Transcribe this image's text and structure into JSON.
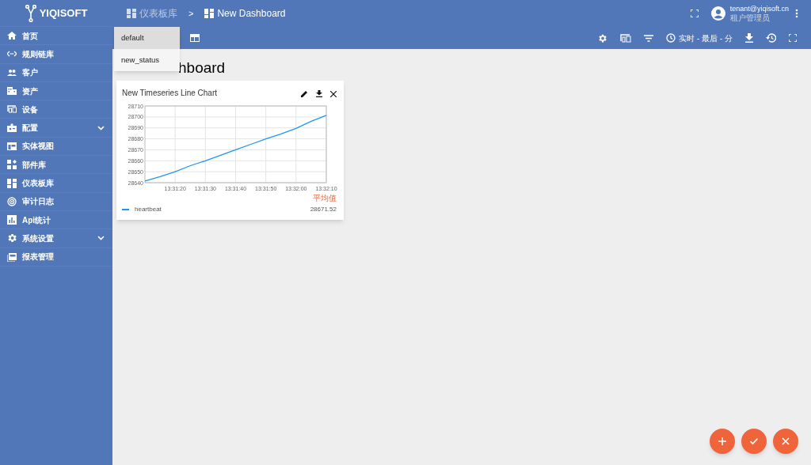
{
  "logo": {
    "text": "YIQISOFT"
  },
  "breadcrumb": [
    {
      "label": "仪表板库",
      "current": false
    },
    {
      "separator": ">"
    },
    {
      "label": "New Dashboard",
      "current": true
    }
  ],
  "user": {
    "email": "tenant@yiqisoft.cn",
    "role": "租户管理员"
  },
  "sidebar": {
    "items": [
      {
        "label": "首页",
        "expandable": false
      },
      {
        "label": "规则链库",
        "expandable": false
      },
      {
        "label": "客户",
        "expandable": false
      },
      {
        "label": "资产",
        "expandable": false
      },
      {
        "label": "设备",
        "expandable": false
      },
      {
        "label": "配置",
        "expandable": true
      },
      {
        "label": "实体视图",
        "expandable": false
      },
      {
        "label": "部件库",
        "expandable": false
      },
      {
        "label": "仪表板库",
        "expandable": false
      },
      {
        "label": "审计日志",
        "expandable": false
      },
      {
        "label": "Api统计",
        "expandable": false
      },
      {
        "label": "系统设置",
        "expandable": true
      },
      {
        "label": "报表管理",
        "expandable": false
      }
    ]
  },
  "toolbar": {
    "timewindow": "实时 - 最后 - 分"
  },
  "state_menu": {
    "items": [
      {
        "label": "default",
        "selected": true
      },
      {
        "label": "new_status",
        "selected": false
      }
    ]
  },
  "dashboard_title": "hboard",
  "widget": {
    "title": "New Timeseries Line Chart",
    "legend_header": "平均值",
    "legend_values": [
      "28671.52"
    ],
    "chart_data": {
      "type": "line",
      "categories": [
        null,
        null,
        "13:31:20",
        null,
        "13:31:30",
        null,
        "13:31:40",
        null,
        "13:31:50",
        null,
        "13:32:00",
        null,
        "13:32:10"
      ],
      "series": [
        {
          "name": "heartbeat",
          "color": "#2196f3",
          "values": [
            28641.5,
            28645.5,
            28650,
            28655.5,
            28660,
            28665,
            28670,
            28675,
            28680,
            28684.5,
            28689.5,
            28696,
            28701.5
          ]
        }
      ],
      "ylim": [
        28640,
        28710
      ],
      "grid": true,
      "yticks": [
        28640,
        28650,
        28660,
        28670,
        28680,
        28690,
        28700,
        28710
      ]
    }
  },
  "fabs": [
    {
      "kind": "add"
    },
    {
      "kind": "apply"
    },
    {
      "kind": "cancel"
    }
  ]
}
